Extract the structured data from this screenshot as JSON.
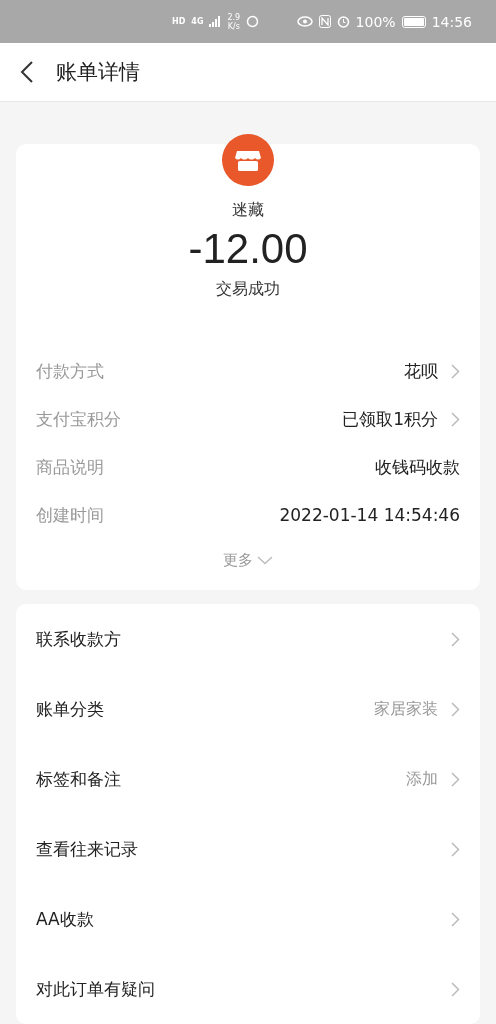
{
  "status_bar": {
    "hd": "HD",
    "network": "4G",
    "speed_value": "2.9",
    "speed_unit": "K/s",
    "battery": "100%",
    "time": "14:56"
  },
  "header": {
    "title": "账单详情"
  },
  "summary": {
    "merchant": "迷藏",
    "amount": "-12.00",
    "status": "交易成功"
  },
  "details": [
    {
      "label": "付款方式",
      "value": "花呗",
      "arrow": true
    },
    {
      "label": "支付宝积分",
      "value": "已领取1积分",
      "arrow": true
    },
    {
      "label": "商品说明",
      "value": "收钱码收款",
      "arrow": false
    },
    {
      "label": "创建时间",
      "value": "2022-01-14 14:54:46",
      "arrow": false
    }
  ],
  "more": "更多",
  "menu": [
    {
      "label": "联系收款方"
    },
    {
      "label": "账单分类",
      "value": "家居家装"
    },
    {
      "label": "标签和备注",
      "value": "添加"
    },
    {
      "label": "查看往来记录"
    },
    {
      "label": "AA收款"
    },
    {
      "label": "对此订单有疑问"
    }
  ]
}
